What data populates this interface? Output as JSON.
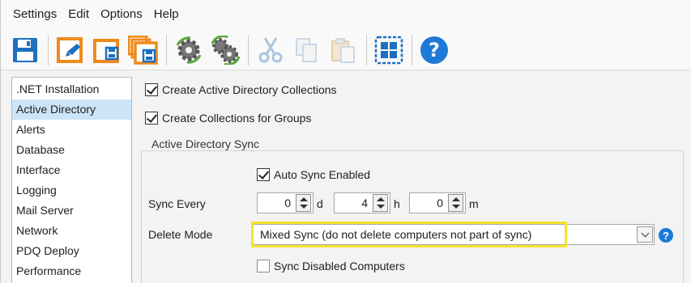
{
  "menu": [
    "Settings",
    "Edit",
    "Options",
    "Help"
  ],
  "toolbar": [
    {
      "name": "save-icon"
    },
    {
      "name": "open-icon"
    },
    {
      "name": "save-copy-icon"
    },
    {
      "name": "save-all-icon"
    },
    {
      "name": "gear-refresh-icon"
    },
    {
      "name": "gears-sync-icon"
    },
    {
      "name": "cut-icon"
    },
    {
      "name": "copy-icon"
    },
    {
      "name": "paste-icon"
    },
    {
      "name": "select-all-icon"
    },
    {
      "name": "help-icon",
      "glyph": "?"
    }
  ],
  "nav": {
    "items": [
      ".NET Installation",
      "Active Directory",
      "Alerts",
      "Database",
      "Interface",
      "Logging",
      "Mail Server",
      "Network",
      "PDQ Deploy",
      "Performance"
    ],
    "selected": "Active Directory"
  },
  "ad": {
    "create_collections": {
      "label": "Create Active Directory Collections",
      "checked": true
    },
    "create_group_collections": {
      "label": "Create Collections for Groups",
      "checked": true
    },
    "sync_group_title": "Active Directory Sync",
    "auto_sync": {
      "label": "Auto Sync Enabled",
      "checked": true
    },
    "sync_every_label": "Sync Every",
    "sync_days": "0",
    "days_unit": "d",
    "sync_hours": "4",
    "hours_unit": "h",
    "sync_minutes": "0",
    "minutes_unit": "m",
    "delete_mode_label": "Delete Mode",
    "delete_mode_value": "Mixed Sync (do not delete computers not part of sync)",
    "sync_disabled": {
      "label": "Sync Disabled Computers",
      "checked": false
    },
    "help_glyph": "?"
  },
  "colors": {
    "accent": "#1e7ad6",
    "selection": "#cce4f7",
    "highlight": "#f5e42c",
    "icon_orange": "#f08a1c",
    "icon_blue": "#1e6fbf"
  }
}
